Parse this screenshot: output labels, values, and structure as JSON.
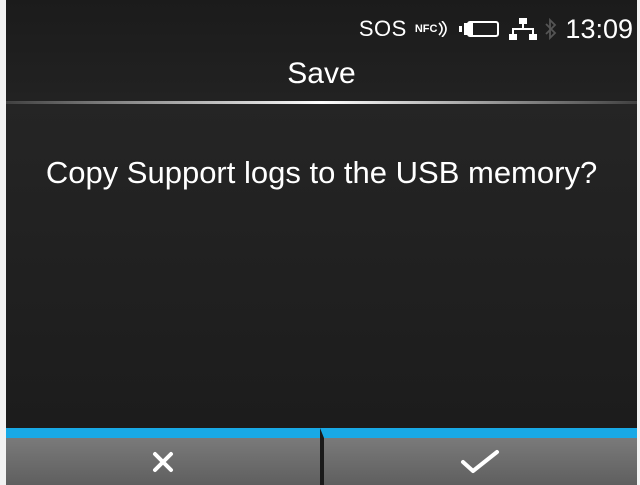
{
  "status": {
    "sos": "SOS",
    "nfc": "NFC",
    "time": "13:09"
  },
  "icons": [
    "nfc-icon",
    "battery-icon",
    "network-icon",
    "bluetooth-icon",
    "cancel-icon",
    "confirm-icon"
  ],
  "header": {
    "title": "Save"
  },
  "dialog": {
    "message": "Copy Support logs to the USB memory?"
  },
  "colors": {
    "accent": "#18a9e6",
    "background": "#1f1f1f",
    "button": "#6a6a6a"
  }
}
